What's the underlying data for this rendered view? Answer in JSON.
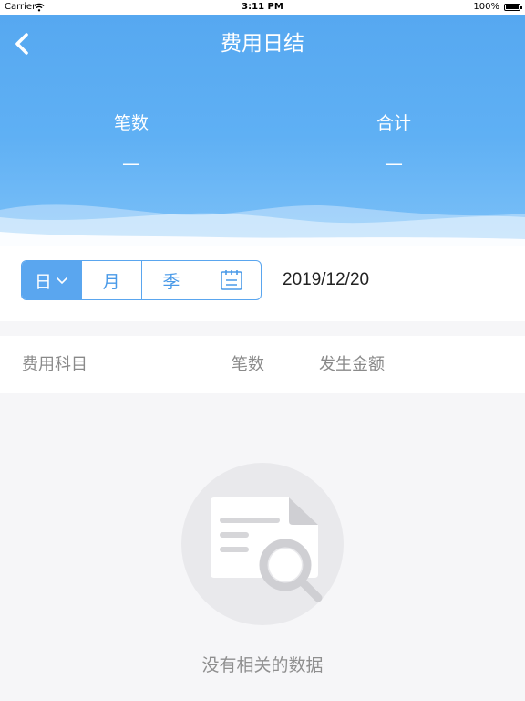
{
  "status_bar": {
    "carrier": "Carrier",
    "time": "3:11 PM",
    "battery": "100%"
  },
  "header": {
    "title": "费用日结",
    "back_icon": "chevron-left-icon"
  },
  "summary": {
    "count_label": "笔数",
    "count_value": "—",
    "total_label": "合计",
    "total_value": "—"
  },
  "filter": {
    "periods": [
      {
        "label": "日",
        "active": true
      },
      {
        "label": "月",
        "active": false
      },
      {
        "label": "季",
        "active": false
      }
    ],
    "calendar_icon": "calendar-icon",
    "date": "2019/12/20"
  },
  "table": {
    "columns": [
      "费用科目",
      "笔数",
      "发生金额"
    ]
  },
  "empty_state": {
    "icon": "document-search-icon",
    "message": "没有相关的数据"
  },
  "colors": {
    "accent": "#5aa6ef",
    "header_top": "#55a7f0",
    "background": "#f6f6f8"
  }
}
